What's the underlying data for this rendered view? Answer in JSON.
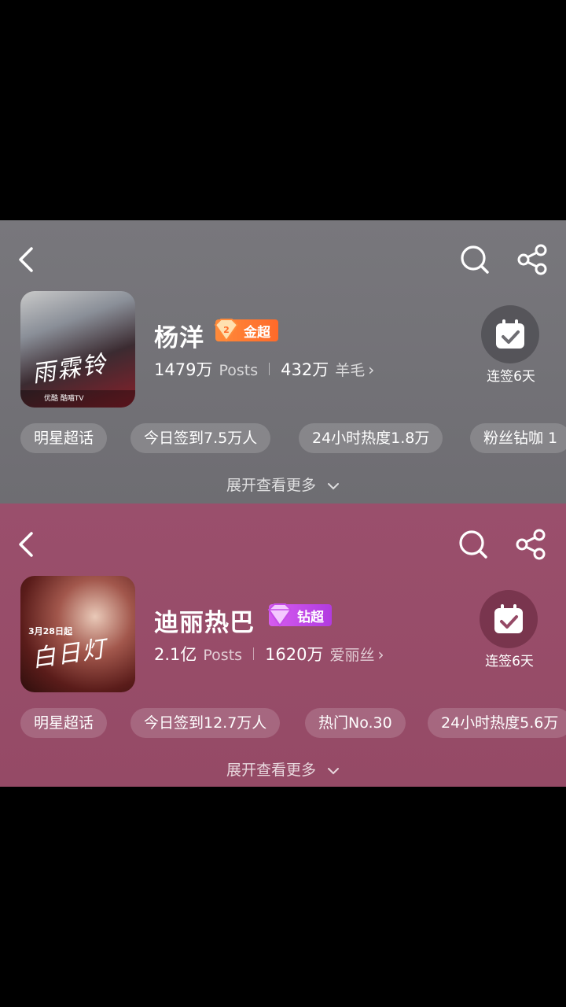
{
  "panels": [
    {
      "name": "杨洋",
      "badge": "金超",
      "posts_count": "1479万",
      "posts_label": "Posts",
      "fans_count": "432万",
      "fans_label": "羊毛",
      "checkin_label": "连签6天",
      "cover": {
        "title": "雨霖铃",
        "strip": "优酷  酷喵TV"
      },
      "chips": [
        "明星超话",
        "今日签到7.5万人",
        "24小时热度1.8万",
        "粉丝钻咖 1"
      ],
      "expand_label": "展开查看更多",
      "badge_color": "#ff7a30"
    },
    {
      "name": "迪丽热巴",
      "badge": "钻超",
      "posts_count": "2.1亿",
      "posts_label": "Posts",
      "fans_count": "1620万",
      "fans_label": "爱丽丝",
      "checkin_label": "连签6天",
      "cover": {
        "title": "白日灯",
        "date": "3月28日起"
      },
      "chips": [
        "明星超话",
        "今日签到12.7万人",
        "热门No.30",
        "24小时热度5.6万"
      ],
      "expand_label": "展开查看更多",
      "badge_color": "#c64de8"
    }
  ]
}
